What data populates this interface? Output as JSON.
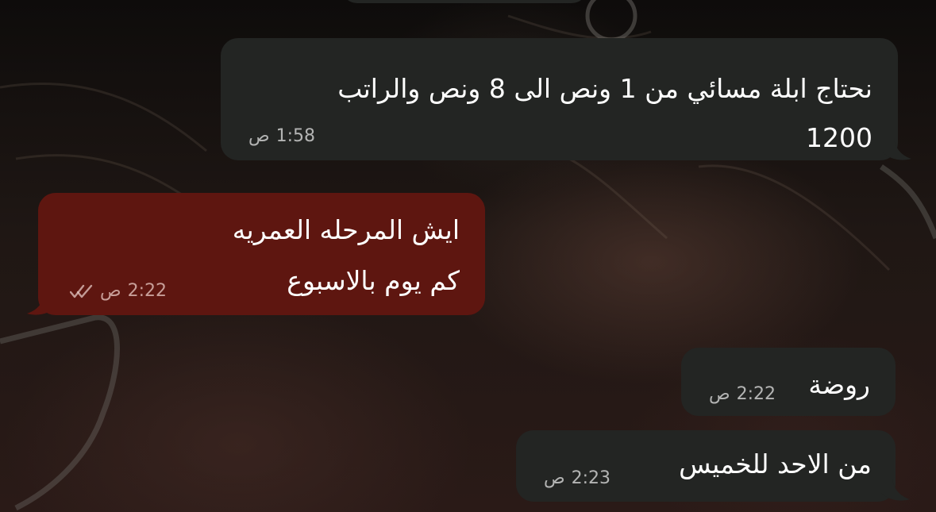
{
  "messages": [
    {
      "direction": "incoming",
      "lines": [
        "نحتاج ابلة مسائي من 1 ونص الى 8 ونص والراتب",
        "1200"
      ],
      "time": "1:58",
      "period": "ص"
    },
    {
      "direction": "outgoing",
      "lines": [
        "ايش المرحله العمريه",
        "كم يوم بالاسبوع"
      ],
      "time": "2:22",
      "period": "ص",
      "status": "read"
    },
    {
      "direction": "incoming",
      "lines": [
        "روضة"
      ],
      "time": "2:22",
      "period": "ص"
    },
    {
      "direction": "incoming",
      "lines": [
        "من الاحد للخميس"
      ],
      "time": "2:23",
      "period": "ص"
    }
  ],
  "colors": {
    "incoming_bubble": "#232523",
    "outgoing_bubble": "#5e1610",
    "text": "#ffffff"
  },
  "icons": {
    "read_receipt": "double-check-icon"
  }
}
